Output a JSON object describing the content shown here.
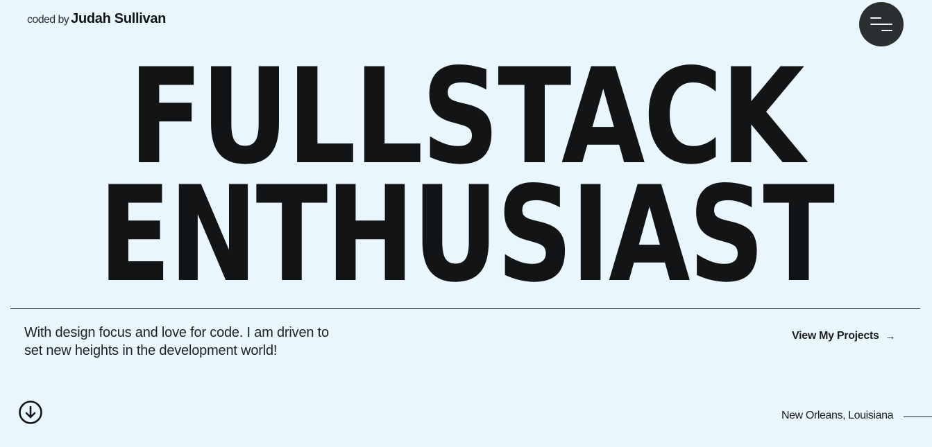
{
  "header": {
    "brand_prefix": "coded by",
    "brand_name": "Judah Sullivan",
    "menu_icon": "hamburger-icon"
  },
  "hero": {
    "line1": "FULLSTACK",
    "line2": "ENTHUSIAST"
  },
  "intro": {
    "tagline": "With design focus and love for code. I am driven to set new heights in the development world!",
    "projects_label": "View My Projects",
    "projects_arrow": "→"
  },
  "footer": {
    "scroll_icon": "arrow-down-circle-icon",
    "location": "New Orleans, Louisiana"
  },
  "colors": {
    "background": "#eaf6fd",
    "text": "#121416",
    "menu_button": "#2c2f31"
  }
}
